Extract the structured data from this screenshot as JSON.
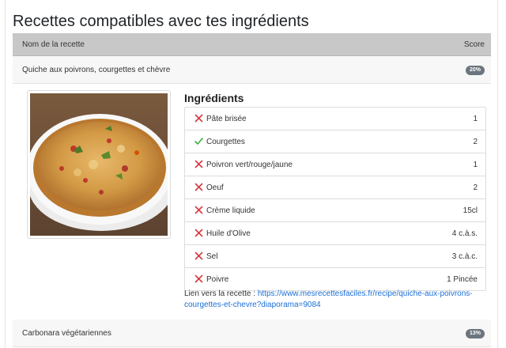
{
  "page": {
    "title": "Recettes compatibles avec tes ingrédients"
  },
  "table": {
    "header_name": "Nom de la recette",
    "header_score": "Score"
  },
  "recipes": [
    {
      "name": "Quiche aux poivrons, courgettes et chèvre",
      "score": "20%"
    },
    {
      "name": "Carbonara végétariennes",
      "score": "13%"
    }
  ],
  "detail": {
    "ingredients_title": "Ingrédients",
    "ingredients": [
      {
        "name": "Pâte brisée",
        "qty": "1",
        "available": false
      },
      {
        "name": "Courgettes",
        "qty": "2",
        "available": true
      },
      {
        "name": "Poivron vert/rouge/jaune",
        "qty": "1",
        "available": false
      },
      {
        "name": "Oeuf",
        "qty": "2",
        "available": false
      },
      {
        "name": "Crème liquide",
        "qty": "15cl",
        "available": false
      },
      {
        "name": "Huile d'Olive",
        "qty": "4 c.à.s.",
        "available": false
      },
      {
        "name": "Sel",
        "qty": "3 c.à.c.",
        "available": false
      },
      {
        "name": "Poivre",
        "qty": "1 Pincée",
        "available": false
      }
    ],
    "link_label": "Lien vers la recette : ",
    "link_url": "https://www.mesrecettesfaciles.fr/recipe/quiche-aux-poivrons-courgettes-et-chevre?diaporama=9084"
  },
  "colors": {
    "missing": "#d9363e",
    "available": "#3cb043",
    "link": "#1a6fd6",
    "badge": "#6c757d"
  },
  "icons": {
    "missing": "cross-icon",
    "available": "check-icon"
  }
}
